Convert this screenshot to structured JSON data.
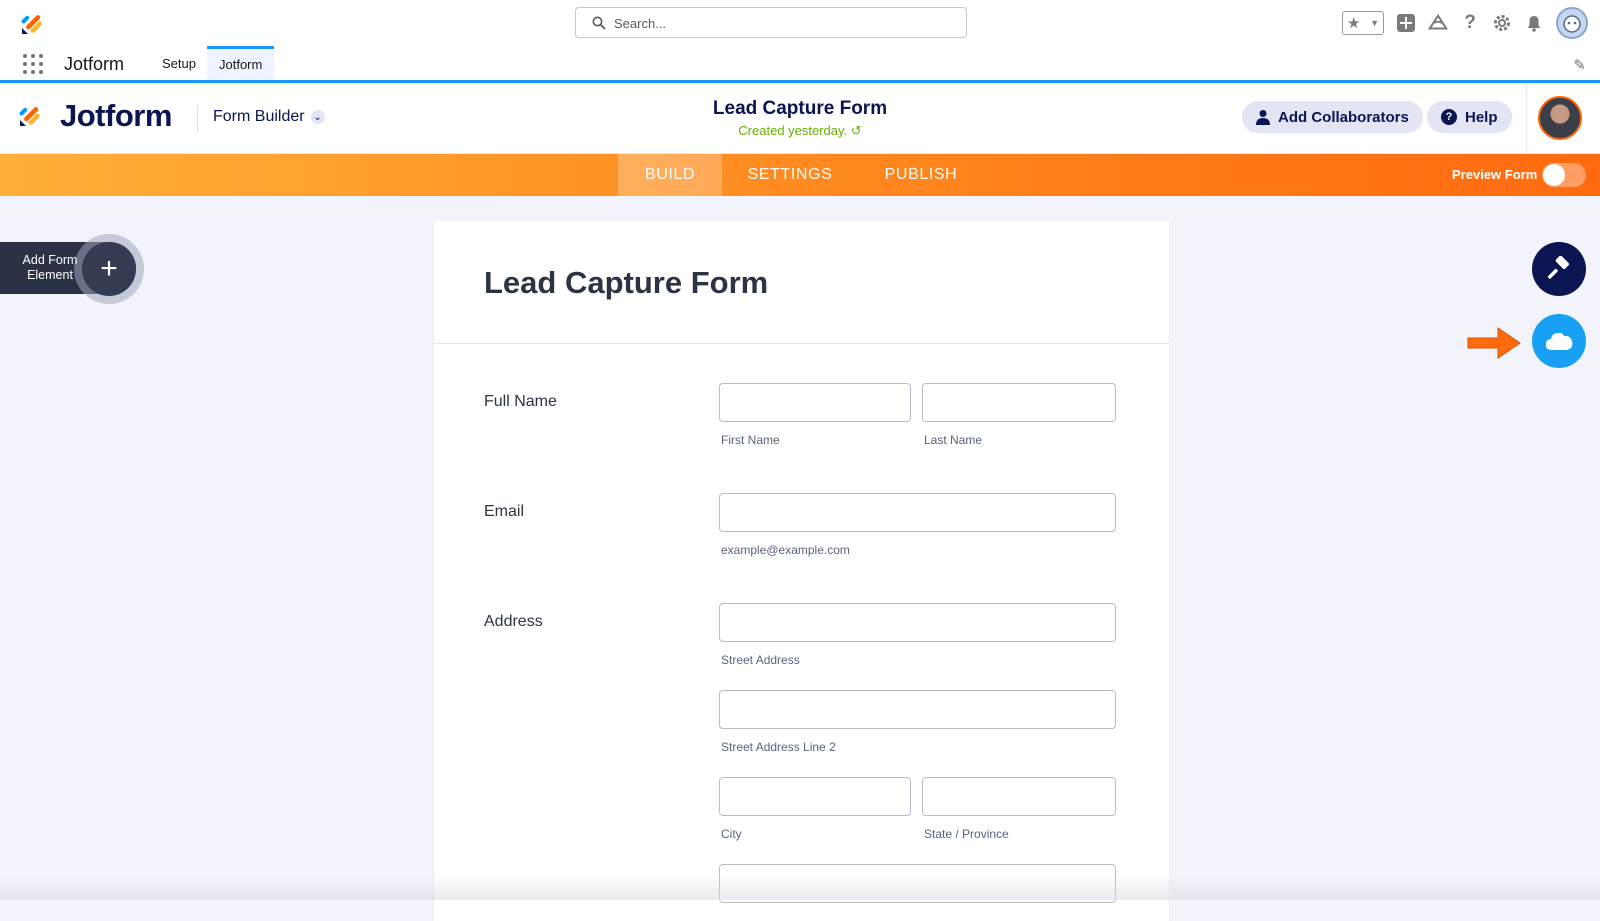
{
  "topbar": {
    "search_placeholder": "Search...",
    "icons": [
      "favorites-star-icon",
      "add-icon",
      "trailhead-icon",
      "help-icon",
      "setup-gear-icon",
      "notifications-bell-icon",
      "user-avatar"
    ]
  },
  "nav": {
    "app_name": "Jotform",
    "tabs": [
      {
        "label": "Setup",
        "active": false
      },
      {
        "label": "Jotform",
        "active": true
      }
    ]
  },
  "header": {
    "brand": "Jotform",
    "builder_label": "Form Builder",
    "form_title": "Lead Capture Form",
    "created": "Created yesterday.",
    "add_collaborators": "Add Collaborators",
    "help": "Help"
  },
  "tabs": {
    "build": "BUILD",
    "settings": "SETTINGS",
    "publish": "PUBLISH",
    "active": "BUILD",
    "preview_label": "Preview Form",
    "preview_on": false
  },
  "add_element": {
    "label": "Add Form Element"
  },
  "form": {
    "title": "Lead Capture Form",
    "fields": {
      "full_name": {
        "label": "Full Name",
        "first": "First Name",
        "last": "Last Name"
      },
      "email": {
        "label": "Email",
        "hint": "example@example.com"
      },
      "address": {
        "label": "Address",
        "street": "Street Address",
        "street2": "Street Address Line 2",
        "city": "City",
        "state": "State / Province"
      }
    }
  },
  "colors": {
    "accent_blue": "#1b96ff",
    "jotform_navy": "#0a1551",
    "orange_start": "#ffb03a",
    "orange_end": "#ff6a10",
    "salesforce_blue": "#18a0f5",
    "created_green": "#64b200"
  }
}
